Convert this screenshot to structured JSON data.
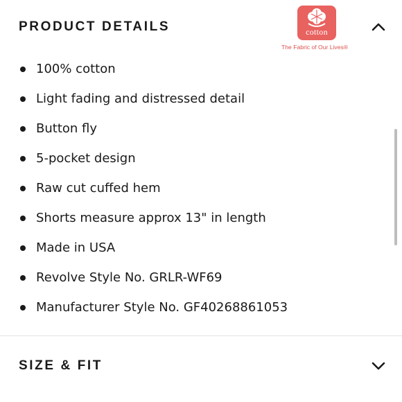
{
  "sections": {
    "details": {
      "title": "PRODUCT DETAILS",
      "toggle_icon": "chevron-up-icon",
      "expanded": true,
      "bullets": [
        "100% cotton",
        "Light fading and distressed detail",
        "Button fly",
        "5-pocket design",
        "Raw cut cuffed hem",
        "Shorts measure approx 13\" in length",
        "Made in USA",
        "Revolve Style No. GRLR-WF69",
        "Manufacturer Style No. GF40268861053"
      ]
    },
    "size_fit": {
      "title": "SIZE & FIT",
      "toggle_icon": "chevron-down-icon",
      "expanded": false
    }
  },
  "logo": {
    "word": "cotton",
    "tagline": "The Fabric of Our Lives®",
    "icon": "cotton-boll-icon"
  },
  "colors": {
    "text": "#1a1a1a",
    "logo_red": "#e8625f",
    "divider": "#e2e2e2",
    "scrollbar": "#bdbdbd"
  }
}
